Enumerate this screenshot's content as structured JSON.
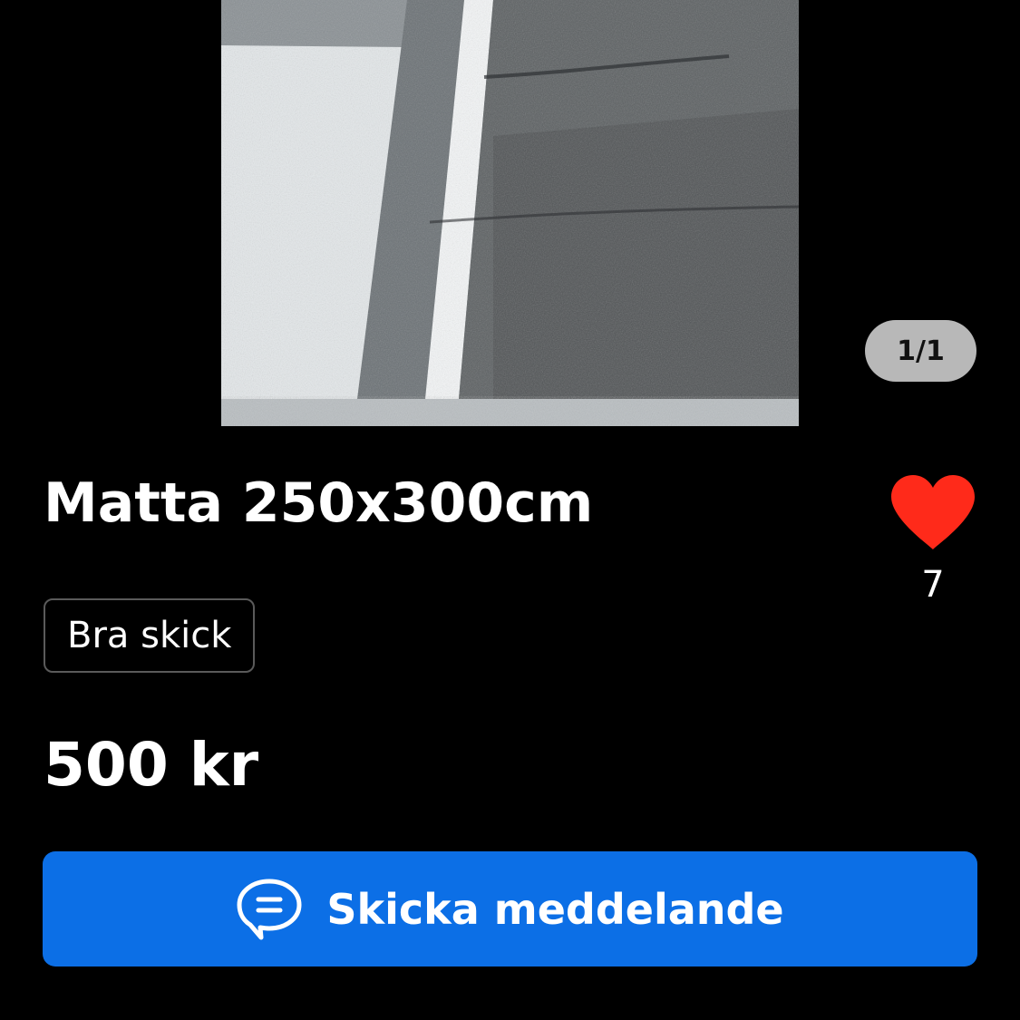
{
  "listing": {
    "image_counter": "1/1",
    "title": "Matta 250x300cm",
    "favorite_count": "7",
    "condition": "Bra skick",
    "price": "500 kr"
  },
  "actions": {
    "send_message_label": "Skicka meddelande"
  },
  "icons": {
    "favorite": "heart-icon",
    "message": "chat-bubble-icon"
  },
  "colors": {
    "background": "#000000",
    "accent": "#0c6fe6",
    "heart": "#ff2a1a",
    "counter_pill": "#b8b8b8"
  }
}
